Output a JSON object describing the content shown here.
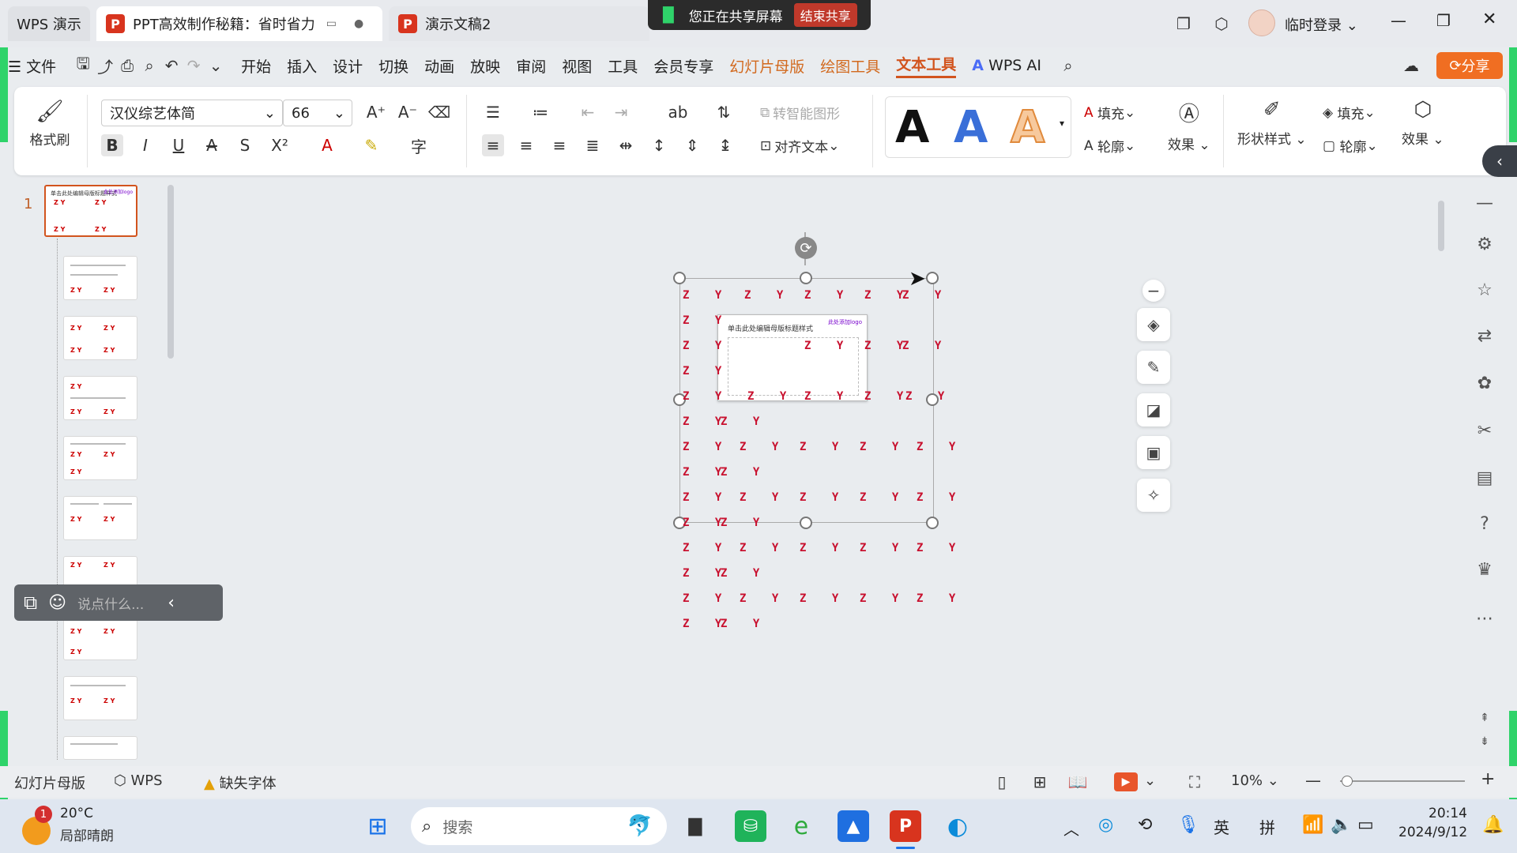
{
  "window": {
    "app_tab": "WPS 演示",
    "tabs": [
      {
        "label": "PPT高效制作秘籍：省时省力"
      },
      {
        "label": "演示文稿2"
      }
    ],
    "share_banner": {
      "text": "您正在共享屏幕",
      "end_button": "结束共享"
    },
    "user": "临时登录"
  },
  "menu": {
    "file": "文件",
    "items": [
      "开始",
      "插入",
      "设计",
      "切换",
      "动画",
      "放映",
      "审阅",
      "视图",
      "工具",
      "会员专享"
    ],
    "context_tabs": [
      "幻灯片母版",
      "绘图工具"
    ],
    "active_tab": "文本工具",
    "wps_ai": "WPS AI",
    "share": "分享"
  },
  "ribbon": {
    "format_painter": "格式刷",
    "font_name": "汉仪综艺体简",
    "font_size": "66",
    "smart_shape": "转智能图形",
    "align_text": "对齐文本",
    "fill": "填充",
    "outline": "轮廓",
    "effect": "效果",
    "shape_style": "形状样式",
    "shape_fill": "填充",
    "shape_outline": "轮廓",
    "shape_effect": "效果",
    "art_letters": [
      "A",
      "A",
      "A"
    ]
  },
  "slides": {
    "current_number": "1",
    "thumb_text": "单击此处编辑母版标题样式",
    "thumb_badge": "此处添加logo"
  },
  "pattern": {
    "token": "Z Y"
  },
  "chat": {
    "placeholder": "说点什么..."
  },
  "status": {
    "mode": "幻灯片母版",
    "wps": "WPS",
    "missing_font": "缺失字体",
    "zoom": "10%"
  },
  "taskbar": {
    "weather_temp": "20°C",
    "weather_desc": "局部晴朗",
    "weather_badge": "1",
    "search": "搜索",
    "ime_lang": "英",
    "ime_mode": "拼",
    "time": "20:14",
    "date": "2024/9/12"
  },
  "colors": {
    "accent": "#d2541e",
    "share_green": "#2fd36a",
    "pattern_red": "#c8102e"
  }
}
